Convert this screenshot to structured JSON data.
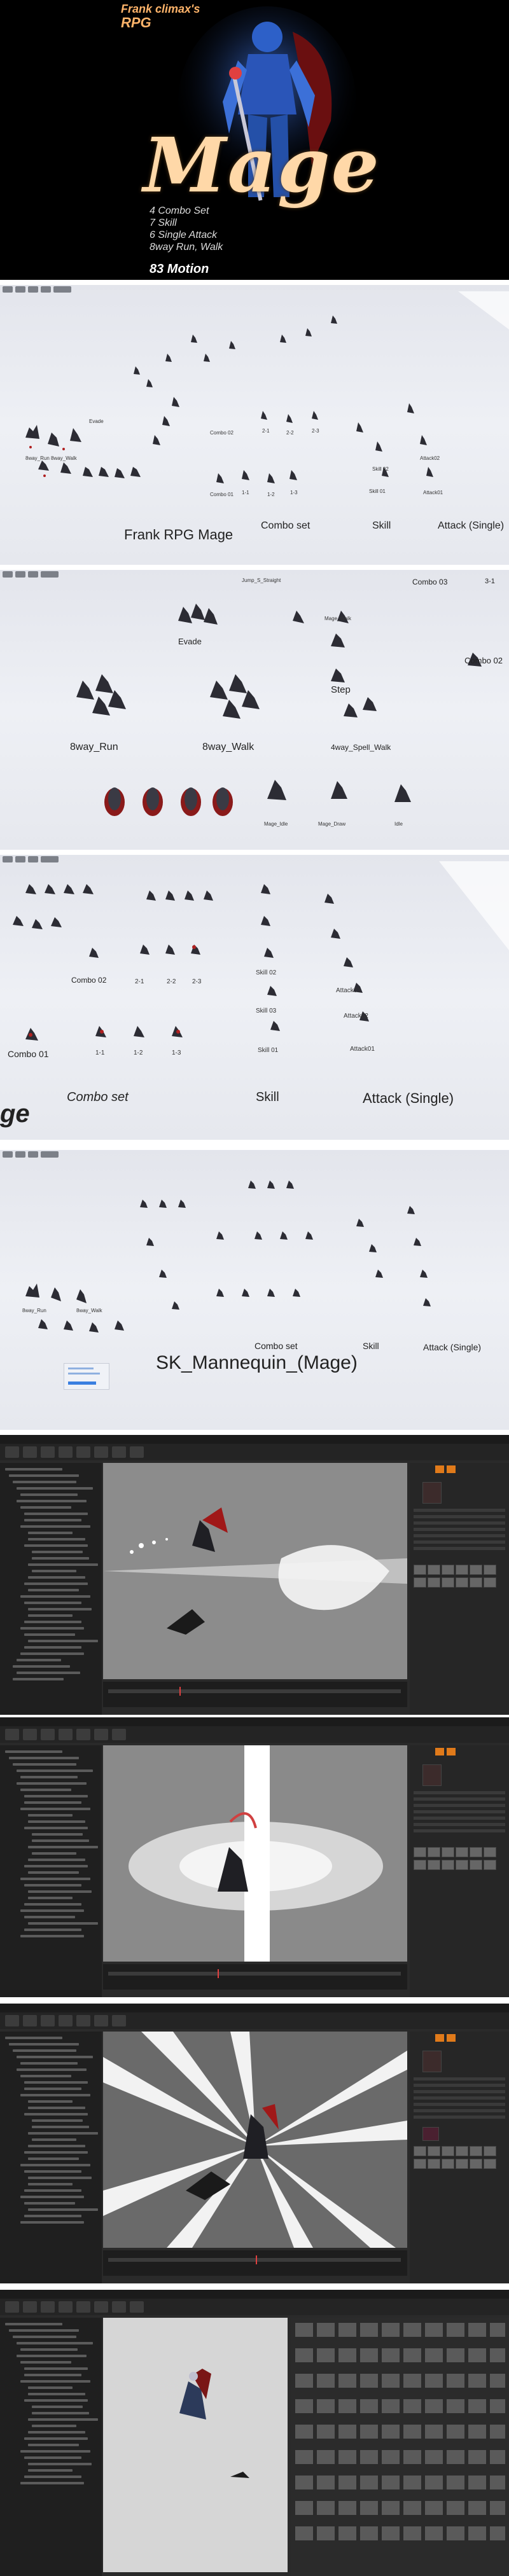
{
  "hero": {
    "brand_line1": "Frank climax's",
    "brand_line2": "RPG",
    "title": "Mage",
    "features": [
      "4 Combo Set",
      "7 Skill",
      "6 Single Attack",
      "8way Run, Walk"
    ],
    "motion_count": "83 Motion"
  },
  "panel1": {
    "main_label": "Frank RPG Mage",
    "combo_label": "Combo set",
    "skill_label": "Skill",
    "attack_label": "Attack (Single)",
    "small": [
      "Combo 01",
      "1-1",
      "1-2",
      "1-3",
      "Combo 02",
      "2-1",
      "2-2",
      "2-3",
      "Skill 01",
      "Skill 02",
      "Attack01",
      "Attack02",
      "Evade",
      "8way_Run",
      "8way_Walk"
    ]
  },
  "panel2": {
    "evade": "Evade",
    "run": "8way_Run",
    "walk": "8way_Walk",
    "step": "Step",
    "spell_walk": "4way_Spell_Walk",
    "combo02": "Combo 02",
    "combo03": "Combo 03",
    "three_one": "3-1",
    "mage_idle": "Mage_Idle",
    "mage_draw": "Mage_Draw",
    "idle": "Idle",
    "jump": "Jump_S_Straight",
    "mage_walk": "Mage_Walk"
  },
  "panel3": {
    "combo01": "Combo 01",
    "combo02": "Combo 02",
    "c11": "1-1",
    "c12": "1-2",
    "c13": "1-3",
    "c21": "2-1",
    "c22": "2-2",
    "c23": "2-3",
    "skill01": "Skill 01",
    "skill02": "Skill 02",
    "skill03": "Skill 03",
    "attack01": "Attack01",
    "attack02": "Attack02",
    "attack03": "Attack03",
    "combo_label": "Combo set",
    "skill_label": "Skill",
    "attack_label": "Attack (Single)",
    "edge_text": "ge"
  },
  "panel4": {
    "mannequin": "SK_Mannequin_(Mage)",
    "combo_label": "Combo set",
    "skill_label": "Skill",
    "attack_label": "Attack (Single)",
    "run": "8way_Run",
    "walk": "8way_Walk"
  }
}
